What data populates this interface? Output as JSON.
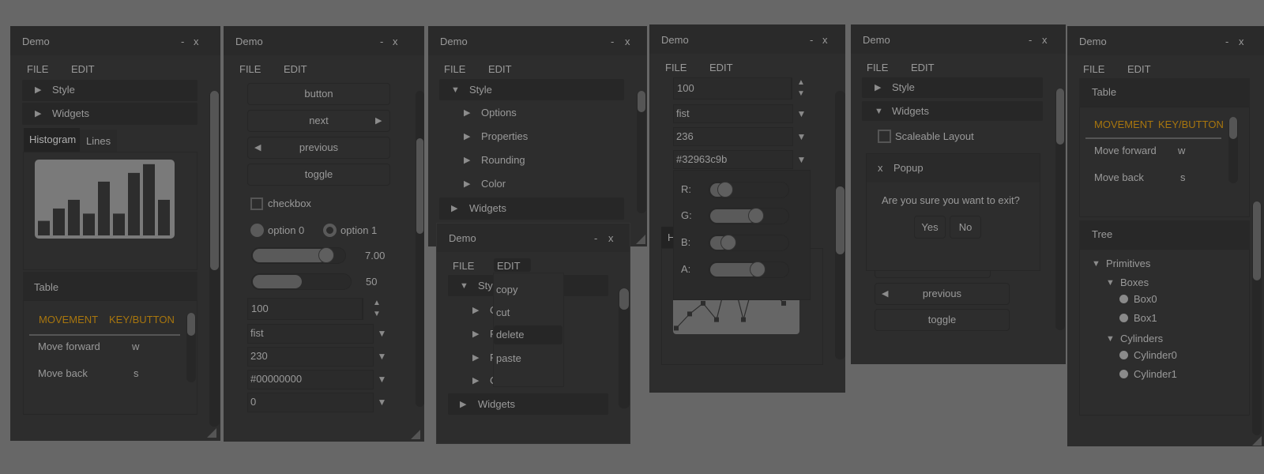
{
  "colors": {
    "background": "#676767",
    "window": "#2d2d2d",
    "accent": "#a8760e",
    "text": "#9a9a9a"
  },
  "w1": {
    "title": "Demo",
    "minimize": "-",
    "close": "x",
    "menu": [
      "FILE",
      "EDIT"
    ],
    "headers": [
      "Style",
      "Widgets"
    ],
    "tabs": [
      "Histogram",
      "Lines"
    ],
    "active_tab": "Histogram",
    "histogram": [
      0.2,
      0.37,
      0.49,
      0.3,
      0.74,
      0.3,
      0.86,
      0.98,
      0.49
    ],
    "table": {
      "title": "Table",
      "columns": [
        "MOVEMENT",
        "KEY/BUTTON"
      ],
      "rows": [
        [
          "Move forward",
          "w"
        ],
        [
          "Move back",
          "s"
        ]
      ]
    }
  },
  "w2": {
    "title": "Demo",
    "minimize": "-",
    "close": "x",
    "menu": [
      "FILE",
      "EDIT"
    ],
    "buttons": [
      "button",
      "next",
      "previous",
      "toggle"
    ],
    "checkbox": {
      "label": "checkbox",
      "checked": false
    },
    "radios": [
      "option 0",
      "option 1"
    ],
    "radio_selected": "option 1",
    "slider_float": {
      "value": "7.00",
      "fraction": 0.8
    },
    "slider_int": {
      "value": "50",
      "fraction": 0.5
    },
    "property": "100",
    "combos": [
      "fist",
      "230",
      "#00000000",
      "0"
    ]
  },
  "w3": {
    "title": "Demo",
    "minimize": "-",
    "close": "x",
    "menu": [
      "FILE",
      "EDIT"
    ],
    "headers": [
      "Style",
      "Widgets"
    ],
    "style_items": [
      "Options",
      "Properties",
      "Rounding",
      "Color"
    ]
  },
  "w4": {
    "title": "Demo",
    "minimize": "-",
    "close": "x",
    "menu": [
      "FILE",
      "EDIT"
    ],
    "headers": [
      "Style",
      "Widgets"
    ],
    "edit_menu": [
      "copy",
      "cut",
      "delete",
      "paste"
    ],
    "highlighted": "delete"
  },
  "w5": {
    "title": "Demo",
    "minimize": "-",
    "close": "x",
    "menu": [
      "FILE",
      "EDIT"
    ],
    "property": "100",
    "combos": [
      "fist",
      "236",
      "#32963c9b"
    ],
    "color_picker": {
      "labels": [
        "R:",
        "G:",
        "B:",
        "A:"
      ],
      "values": [
        0.196,
        0.588,
        0.235,
        0.608
      ]
    },
    "line_chart": [
      0.04,
      0.24,
      0.39,
      0.16,
      0.9,
      0.16,
      0.85,
      0.6,
      0.39
    ]
  },
  "w6": {
    "title": "Demo",
    "minimize": "-",
    "close": "x",
    "menu": [
      "FILE",
      "EDIT"
    ],
    "headers": [
      "Style",
      "Widgets"
    ],
    "checkbox": {
      "label": "Scaleable Layout",
      "checked": false
    },
    "popup": {
      "close": "x",
      "title": "Popup",
      "message": "Are you sure you want to exit?",
      "yes": "Yes",
      "no": "No"
    },
    "buttons": [
      "previous",
      "toggle"
    ]
  },
  "w7": {
    "title": "Demo",
    "minimize": "-",
    "close": "x",
    "menu": [
      "FILE",
      "EDIT"
    ],
    "table": {
      "title": "Table",
      "columns": [
        "MOVEMENT",
        "KEY/BUTTON"
      ],
      "rows": [
        [
          "Move forward",
          "w"
        ],
        [
          "Move back",
          "s"
        ]
      ]
    },
    "tree": {
      "title": "Tree",
      "root": "Primitives",
      "groups": [
        {
          "label": "Boxes",
          "items": [
            "Box0",
            "Box1"
          ]
        },
        {
          "label": "Cylinders",
          "items": [
            "Cylinder0",
            "Cylinder1"
          ]
        }
      ]
    }
  }
}
